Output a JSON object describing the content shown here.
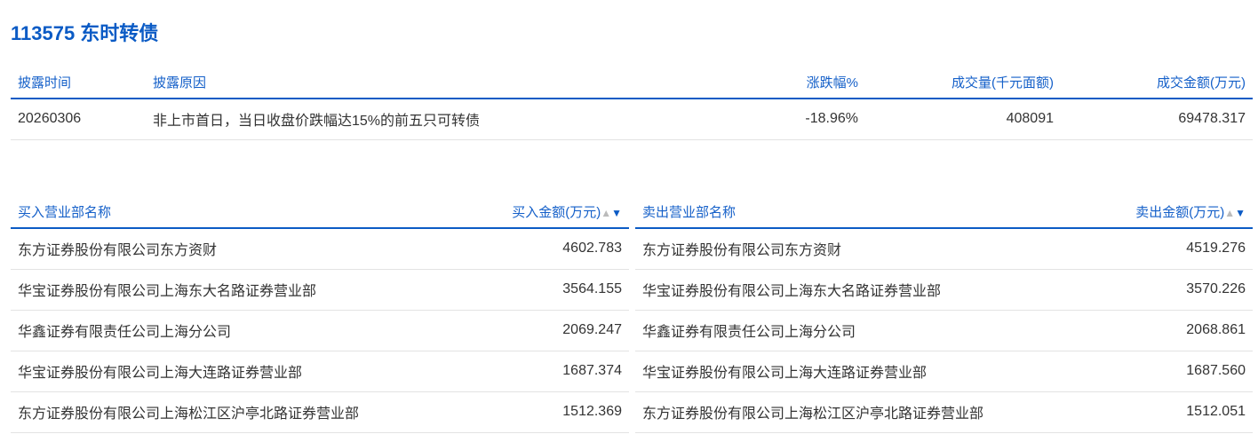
{
  "title": "113575 东时转债",
  "disclosure": {
    "headers": [
      "披露时间",
      "披露原因",
      "涨跌幅%",
      "成交量(千元面额)",
      "成交金额(万元)"
    ],
    "row": [
      "20260306",
      "非上市首日，当日收盘价跌幅达15%的前五只可转债",
      "-18.96%",
      "408091",
      "69478.317"
    ]
  },
  "buy": {
    "headers": [
      "买入营业部名称",
      "买入金额(万元)"
    ],
    "rows": [
      [
        "东方证券股份有限公司东方资财",
        "4602.783"
      ],
      [
        "华宝证券股份有限公司上海东大名路证券营业部",
        "3564.155"
      ],
      [
        "华鑫证券有限责任公司上海分公司",
        "2069.247"
      ],
      [
        "华宝证券股份有限公司上海大连路证券营业部",
        "1687.374"
      ],
      [
        "东方证券股份有限公司上海松江区沪亭北路证券营业部",
        "1512.369"
      ]
    ]
  },
  "sell": {
    "headers": [
      "卖出营业部名称",
      "卖出金额(万元)"
    ],
    "rows": [
      [
        "东方证券股份有限公司东方资财",
        "4519.276"
      ],
      [
        "华宝证券股份有限公司上海东大名路证券营业部",
        "3570.226"
      ],
      [
        "华鑫证券有限责任公司上海分公司",
        "2068.861"
      ],
      [
        "华宝证券股份有限公司上海大连路证券营业部",
        "1687.560"
      ],
      [
        "东方证券股份有限公司上海松江区沪亭北路证券营业部",
        "1512.051"
      ]
    ]
  },
  "sort_icons": {
    "up": "▲",
    "down": "▼"
  }
}
